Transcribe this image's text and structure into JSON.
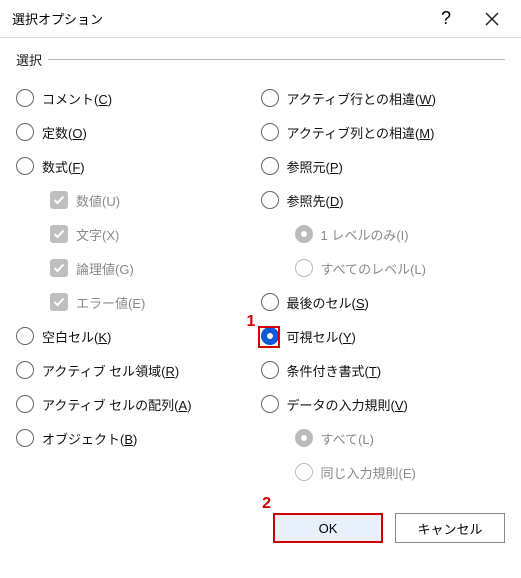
{
  "title": "選択オプション",
  "help_icon": "?",
  "group_label": "選択",
  "left": {
    "comments": "コメント(<u>C</u>)",
    "constants": "定数(<u>O</u>)",
    "formulas": "数式(<u>F</u>)",
    "numbers": "数値(U)",
    "text": "文字(X)",
    "logical": "論理値(G)",
    "errors": "エラー値(E)",
    "blanks": "空白セル(<u>K</u>)",
    "current_region": "アクティブ セル領域(<u>R</u>)",
    "current_array": "アクティブ セルの配列(<u>A</u>)",
    "objects": "オブジェクト(<u>B</u>)"
  },
  "right": {
    "row_diff": "アクティブ行との相違(<u>W</u>)",
    "col_diff": "アクティブ列との相違(<u>M</u>)",
    "precedents": "参照元(<u>P</u>)",
    "dependents": "参照先(<u>D</u>)",
    "one_level": "1 レベルのみ(I)",
    "all_levels": "すべてのレベル(L)",
    "last_cell": "最後のセル(<u>S</u>)",
    "visible_cells": "可視セル(<u>Y</u>)",
    "cond_format": "条件付き書式(<u>T</u>)",
    "data_validation": "データの入力規則(<u>V</u>)",
    "dv_all": "すべて(L)",
    "dv_same": "同じ入力規則(E)"
  },
  "markers": {
    "m1": "1",
    "m2": "2"
  },
  "buttons": {
    "ok": "OK",
    "cancel": "キャンセル"
  }
}
